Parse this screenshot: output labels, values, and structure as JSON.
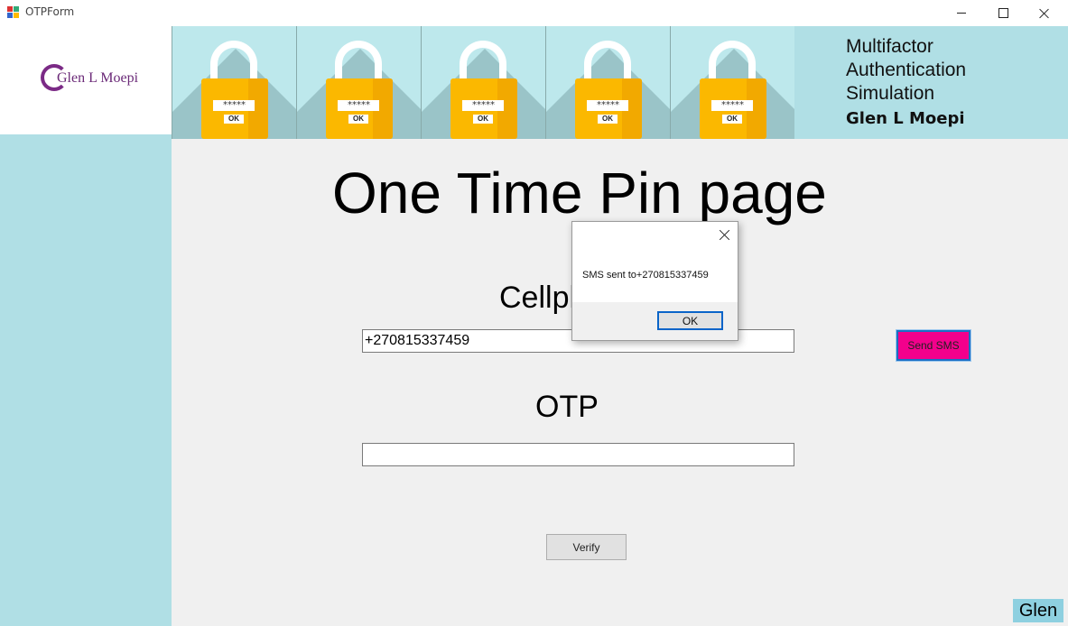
{
  "window": {
    "title": "OTPForm",
    "controls": {
      "minimize": "minimize",
      "maximize": "maximize",
      "close": "close"
    }
  },
  "brand": {
    "logo_text": "Glen L Moepi"
  },
  "banner": {
    "lock_password": "*****",
    "lock_ok": "OK",
    "lock_count": 5,
    "heading_lines": [
      "Multifactor",
      "Authentication",
      "Simulation"
    ],
    "author": "Glen L Moepi"
  },
  "main": {
    "page_title": "One Time Pin page",
    "cellphone_label": "Cellphone",
    "cellphone_value": "+270815337459",
    "otp_label": "OTP",
    "otp_value": "",
    "send_sms_label": "Send SMS",
    "verify_label": "Verify",
    "corner_label": "Glen"
  },
  "dialog": {
    "message": "SMS sent to+270815337459",
    "ok_label": "OK"
  },
  "colors": {
    "panel": "#b0dfe5",
    "send_button": "#f3008c",
    "lock_body": "#fbb800",
    "logo": "#7b2a86"
  }
}
